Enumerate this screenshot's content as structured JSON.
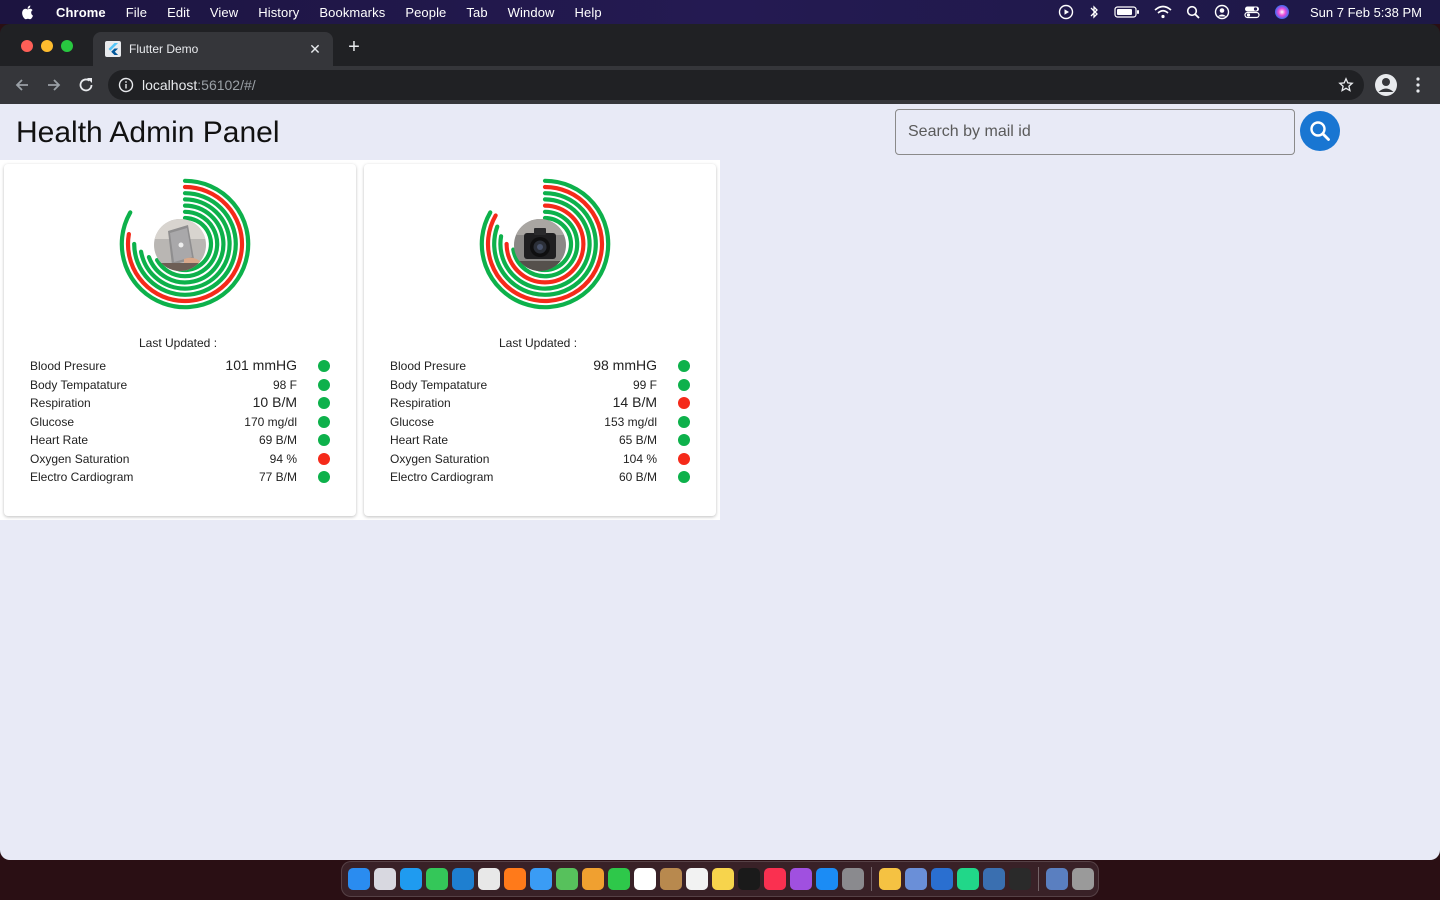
{
  "menubar": {
    "app_name": "Chrome",
    "items": [
      "File",
      "Edit",
      "View",
      "History",
      "Bookmarks",
      "People",
      "Tab",
      "Window",
      "Help"
    ],
    "clock": "Sun 7 Feb  5:38 PM"
  },
  "browser": {
    "tab_title": "Flutter Demo",
    "url_host": "localhost",
    "url_rest": ":56102/#/"
  },
  "app": {
    "title": "Health Admin Panel",
    "search_placeholder": "Search by mail id"
  },
  "colors": {
    "good": "#0db14b",
    "bad": "#f52a1a",
    "accent": "#1976d2"
  },
  "cards": [
    {
      "last_updated": "Last Updated :",
      "avatar": "laptop-photo",
      "metrics": [
        {
          "label": "Blood Presure",
          "value": "101 mmHG",
          "status": "good"
        },
        {
          "label": "Body Tempatature",
          "value": "98 F",
          "status": "good"
        },
        {
          "label": "Respiration",
          "value": "10 B/M",
          "status": "good"
        },
        {
          "label": "Glucose",
          "value": "170 mg/dl",
          "status": "good"
        },
        {
          "label": "Heart Rate",
          "value": "69 B/M",
          "status": "good"
        },
        {
          "label": "Oxygen Saturation",
          "value": "94 %",
          "status": "bad"
        },
        {
          "label": "Electro Cardiogram",
          "value": "77 B/M",
          "status": "good"
        }
      ]
    },
    {
      "last_updated": "Last Updated :",
      "avatar": "camera-photo",
      "metrics": [
        {
          "label": "Blood Presure",
          "value": "98 mmHG",
          "status": "good"
        },
        {
          "label": "Body Tempatature",
          "value": "99 F",
          "status": "good"
        },
        {
          "label": "Respiration",
          "value": "14 B/M",
          "status": "bad"
        },
        {
          "label": "Glucose",
          "value": "153 mg/dl",
          "status": "good"
        },
        {
          "label": "Heart Rate",
          "value": "65 B/M",
          "status": "good"
        },
        {
          "label": "Oxygen Saturation",
          "value": "104 %",
          "status": "bad"
        },
        {
          "label": "Electro Cardiogram",
          "value": "60 B/M",
          "status": "good"
        }
      ]
    }
  ],
  "dock": {
    "icons": [
      "finder-icon",
      "launchpad-icon",
      "safari-icon",
      "messages-icon",
      "vscode-icon",
      "chrome-icon",
      "firefox-icon",
      "mail-icon",
      "maps-icon",
      "photos-icon",
      "facetime-icon",
      "calendar-icon",
      "contacts-icon",
      "reminders-icon",
      "notes-icon",
      "appletv-icon",
      "music-icon",
      "podcasts-icon",
      "appstore-icon",
      "settings-icon",
      "textedit-icon",
      "preview-icon",
      "sourcetree-icon",
      "pycharm-icon",
      "quicktime-icon",
      "terminal-icon",
      "downloads-icon",
      "trash-icon"
    ],
    "icon_colors": [
      "#2a8cf0",
      "#d8d8e0",
      "#1f9bf0",
      "#34c759",
      "#1e7fd0",
      "#e8e8e8",
      "#ff7a1a",
      "#3a9cf5",
      "#57c15c",
      "#f0a030",
      "#2ec84a",
      "#ffffff",
      "#b8894e",
      "#f2f2f2",
      "#f7d44c",
      "#1a1a1a",
      "#fa3050",
      "#a050e0",
      "#1b8cf5",
      "#8a8a8e",
      "#f5c242",
      "#6a8fd8",
      "#2a6fd0",
      "#21d789",
      "#3a6fb0",
      "#2a2a2a",
      "#5a7fc0",
      "#9a9a9a"
    ]
  }
}
